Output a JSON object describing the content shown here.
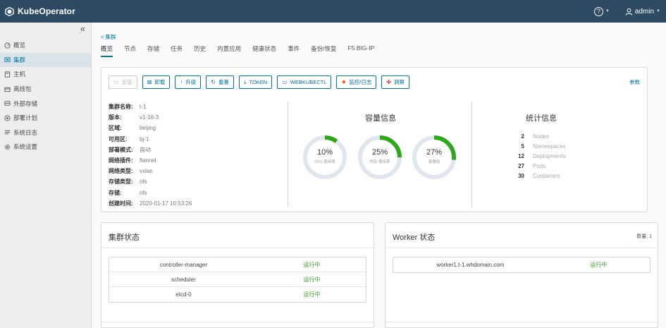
{
  "app": {
    "title": "KubeOperator",
    "user": "admin"
  },
  "icons": {
    "logo": "kubeoperator-logo-icon",
    "help": "help-circle-icon",
    "user": "user-icon",
    "collapse": "double-chevron-left-icon"
  },
  "sidebar": {
    "collapse_label": "«",
    "items": [
      {
        "label": "概览",
        "icon": "dashboard-icon"
      },
      {
        "label": "集群",
        "icon": "cluster-icon",
        "active": true
      },
      {
        "label": "主机",
        "icon": "host-icon"
      },
      {
        "label": "离线包",
        "icon": "package-icon"
      },
      {
        "label": "外部存储",
        "icon": "storage-icon"
      },
      {
        "label": "部署计划",
        "icon": "plan-icon"
      },
      {
        "label": "系统日志",
        "icon": "log-icon"
      },
      {
        "label": "系统设置",
        "icon": "settings-icon"
      }
    ]
  },
  "breadcrumb": {
    "back": "< 集群"
  },
  "tabs": [
    "概览",
    "节点",
    "存储",
    "任务",
    "历史",
    "内置应用",
    "健康状态",
    "事件",
    "备份/恢复",
    "F5 BIG-IP"
  ],
  "toolbar": {
    "install": "安装",
    "uninstall": "卸载",
    "upgrade": "升级",
    "reset": "重置",
    "token": "TOKEN",
    "webkubectl": "WEBKUBECTL",
    "monitor": "监控/日志",
    "insight": "洞察",
    "params": "参数"
  },
  "cluster_info": {
    "rows": [
      {
        "key": "集群名称:",
        "value": "t-1"
      },
      {
        "key": "版本:",
        "value": "v1-16-3"
      },
      {
        "key": "区域:",
        "value": "beijing"
      },
      {
        "key": "可用区:",
        "value": "bj-1"
      },
      {
        "key": "部署模式:",
        "value": "自动"
      },
      {
        "key": "网络插件:",
        "value": "flannel"
      },
      {
        "key": "网络类型:",
        "value": "vxlan"
      },
      {
        "key": "存储类型:",
        "value": "nfs"
      },
      {
        "key": "存储:",
        "value": "nfs"
      },
      {
        "key": "创建时间:",
        "value": "2020-01-17 10:53:26"
      }
    ]
  },
  "capacity": {
    "title": "容量信息",
    "items": [
      {
        "pct_label": "10%",
        "value": 0.1,
        "label": "CPU 使用率"
      },
      {
        "pct_label": "25%",
        "value": 0.25,
        "label": "内存 使用率"
      },
      {
        "pct_label": "27%",
        "value": 0.27,
        "label": "容器组"
      }
    ],
    "colors": {
      "track": "#e0e6ee",
      "fill": "#2ea81b"
    }
  },
  "stats": {
    "title": "统计信息",
    "items": [
      {
        "num": "2",
        "name": "Nodes"
      },
      {
        "num": "5",
        "name": "Namespaces"
      },
      {
        "num": "12",
        "name": "Deployments"
      },
      {
        "num": "27",
        "name": "Pods"
      },
      {
        "num": "30",
        "name": "Containers"
      }
    ]
  },
  "cluster_status": {
    "title": "集群状态",
    "rows": [
      {
        "name": "controller-manager",
        "status": "运行中"
      },
      {
        "name": "scheduler",
        "status": "运行中"
      },
      {
        "name": "etcd-0",
        "status": "运行中"
      }
    ]
  },
  "worker_status": {
    "title": "Worker 状态",
    "count": "数量: 1",
    "rows": [
      {
        "name": "worker1.t-1.whdomain.com",
        "status": "运行中"
      }
    ]
  },
  "colors": {
    "header": "#2e4a63",
    "accent": "#0072a3",
    "running": "#3a9c2a"
  }
}
